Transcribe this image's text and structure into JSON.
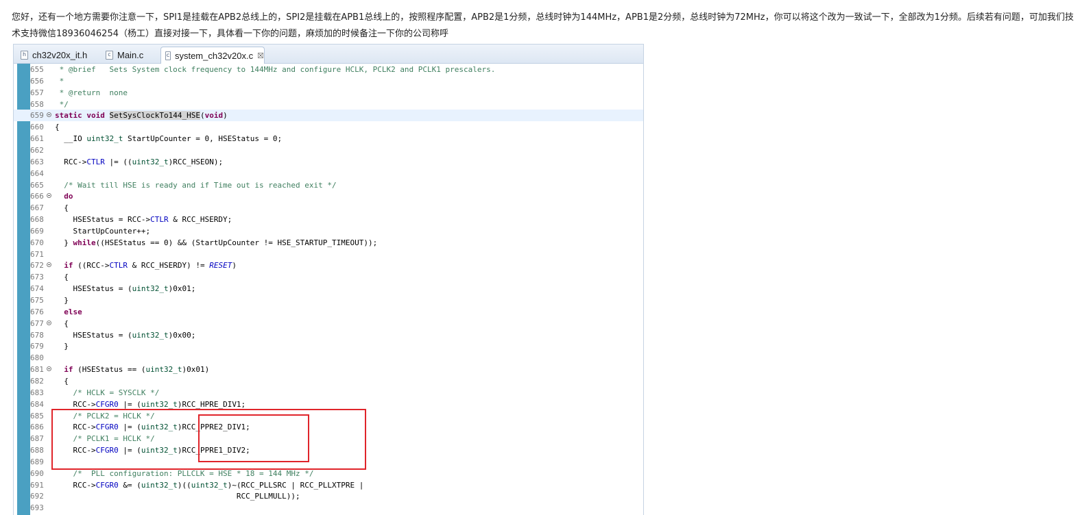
{
  "message": "您好，还有一个地方需要你注意一下，SPI1是挂载在APB2总线上的，SPI2是挂载在APB1总线上的，按照程序配置，APB2是1分频，总线时钟为144MHz，APB1是2分频，总线时钟为72MHz，你可以将这个改为一致试一下，全部改为1分频。后续若有问题，可加我们技术支持微信18936046254（杨工）直接对接一下，具体看一下你的问题，麻烦加的时候备注一下你的公司称呼",
  "tabs": [
    {
      "label": "ch32v20x_it.h",
      "icon": "h",
      "active": false
    },
    {
      "label": "Main.c",
      "icon": "c",
      "active": false
    },
    {
      "label": "system_ch32v20x.c",
      "icon": "c",
      "active": true,
      "close": "☒"
    }
  ],
  "colors": {
    "comment": "#3f7f5f",
    "keyword": "#7f0055",
    "field": "#0000c0",
    "type": "#005032",
    "highlight": "#e0242a",
    "marker": "#4aa0c2"
  },
  "lines": [
    {
      "n": "655",
      "t": [
        [
          "c",
          " * @brief   Sets System clock frequency to 144MHz and configure HCLK, PCLK2 and PCLK1 prescalers."
        ]
      ]
    },
    {
      "n": "656",
      "t": [
        [
          "c",
          " *"
        ]
      ]
    },
    {
      "n": "657",
      "t": [
        [
          "c",
          " * @return  none"
        ]
      ]
    },
    {
      "n": "658",
      "t": [
        [
          "c",
          " */"
        ]
      ]
    },
    {
      "n": "659",
      "fold": true,
      "cur": true,
      "t": [
        [
          "k",
          "static"
        ],
        [
          "",
          " "
        ],
        [
          "k",
          "void"
        ],
        [
          "",
          " "
        ],
        [
          "hl",
          "SetSysClockTo144_HSE"
        ],
        [
          "",
          "("
        ],
        [
          "k",
          "void"
        ],
        [
          "",
          ")"
        ]
      ]
    },
    {
      "n": "660",
      "t": [
        [
          "",
          "{"
        ]
      ]
    },
    {
      "n": "661",
      "t": [
        [
          "",
          "  __IO "
        ],
        [
          "t",
          "uint32_t"
        ],
        [
          "",
          " StartUpCounter = 0, HSEStatus = 0;"
        ]
      ]
    },
    {
      "n": "662",
      "t": []
    },
    {
      "n": "663",
      "t": [
        [
          "",
          "  RCC->"
        ],
        [
          "f",
          "CTLR"
        ],
        [
          "",
          " |= (("
        ],
        [
          "t",
          "uint32_t"
        ],
        [
          "",
          ")RCC_HSEON);"
        ]
      ]
    },
    {
      "n": "664",
      "t": []
    },
    {
      "n": "665",
      "t": [
        [
          "c",
          "  /* Wait till HSE is ready and if Time out is reached exit */"
        ]
      ]
    },
    {
      "n": "666",
      "fold": true,
      "t": [
        [
          "",
          "  "
        ],
        [
          "k",
          "do"
        ]
      ]
    },
    {
      "n": "667",
      "t": [
        [
          "",
          "  {"
        ]
      ]
    },
    {
      "n": "668",
      "t": [
        [
          "",
          "    HSEStatus = RCC->"
        ],
        [
          "f",
          "CTLR"
        ],
        [
          "",
          " & RCC_HSERDY;"
        ]
      ]
    },
    {
      "n": "669",
      "t": [
        [
          "",
          "    StartUpCounter++;"
        ]
      ]
    },
    {
      "n": "670",
      "t": [
        [
          "",
          "  } "
        ],
        [
          "k",
          "while"
        ],
        [
          "",
          "((HSEStatus == 0) && (StartUpCounter != HSE_STARTUP_TIMEOUT));"
        ]
      ]
    },
    {
      "n": "671",
      "t": []
    },
    {
      "n": "672",
      "fold": true,
      "t": [
        [
          "",
          "  "
        ],
        [
          "k",
          "if"
        ],
        [
          "",
          " ((RCC->"
        ],
        [
          "f",
          "CTLR"
        ],
        [
          "",
          " & RCC_HSERDY) != "
        ],
        [
          "i",
          "RESET"
        ],
        [
          "",
          ")"
        ]
      ]
    },
    {
      "n": "673",
      "t": [
        [
          "",
          "  {"
        ]
      ]
    },
    {
      "n": "674",
      "t": [
        [
          "",
          "    HSEStatus = ("
        ],
        [
          "t",
          "uint32_t"
        ],
        [
          "",
          ")0x01;"
        ]
      ]
    },
    {
      "n": "675",
      "t": [
        [
          "",
          "  }"
        ]
      ]
    },
    {
      "n": "676",
      "t": [
        [
          "",
          "  "
        ],
        [
          "k",
          "else"
        ]
      ]
    },
    {
      "n": "677",
      "fold": true,
      "t": [
        [
          "",
          "  {"
        ]
      ]
    },
    {
      "n": "678",
      "t": [
        [
          "",
          "    HSEStatus = ("
        ],
        [
          "t",
          "uint32_t"
        ],
        [
          "",
          ")0x00;"
        ]
      ]
    },
    {
      "n": "679",
      "t": [
        [
          "",
          "  }"
        ]
      ]
    },
    {
      "n": "680",
      "t": []
    },
    {
      "n": "681",
      "fold": true,
      "t": [
        [
          "",
          "  "
        ],
        [
          "k",
          "if"
        ],
        [
          "",
          " (HSEStatus == ("
        ],
        [
          "t",
          "uint32_t"
        ],
        [
          "",
          ")0x01)"
        ]
      ]
    },
    {
      "n": "682",
      "t": [
        [
          "",
          "  {"
        ]
      ]
    },
    {
      "n": "683",
      "t": [
        [
          "c",
          "    /* HCLK = SYSCLK */"
        ]
      ]
    },
    {
      "n": "684",
      "t": [
        [
          "",
          "    RCC->"
        ],
        [
          "f",
          "CFGR0"
        ],
        [
          "",
          " |= ("
        ],
        [
          "t",
          "uint32_t"
        ],
        [
          "",
          ")RCC_HPRE_DIV1;"
        ]
      ]
    },
    {
      "n": "685",
      "t": [
        [
          "c",
          "    /* PCLK2 = HCLK */"
        ]
      ]
    },
    {
      "n": "686",
      "t": [
        [
          "",
          "    RCC->"
        ],
        [
          "f",
          "CFGR0"
        ],
        [
          "",
          " |= ("
        ],
        [
          "t",
          "uint32_t"
        ],
        [
          "",
          ")RCC_PPRE2_DIV1;"
        ]
      ]
    },
    {
      "n": "687",
      "t": [
        [
          "c",
          "    /* PCLK1 = HCLK */"
        ]
      ]
    },
    {
      "n": "688",
      "t": [
        [
          "",
          "    RCC->"
        ],
        [
          "f",
          "CFGR0"
        ],
        [
          "",
          " |= ("
        ],
        [
          "t",
          "uint32_t"
        ],
        [
          "",
          ")RCC_PPRE1_DIV2;"
        ]
      ]
    },
    {
      "n": "689",
      "t": []
    },
    {
      "n": "690",
      "t": [
        [
          "c",
          "    /*  PLL configuration: PLLCLK = HSE * 18 = 144 MHz */"
        ]
      ]
    },
    {
      "n": "691",
      "t": [
        [
          "",
          "    RCC->"
        ],
        [
          "f",
          "CFGR0"
        ],
        [
          "",
          " &= ("
        ],
        [
          "t",
          "uint32_t"
        ],
        [
          "",
          ")(("
        ],
        [
          "t",
          "uint32_t"
        ],
        [
          "",
          ")~(RCC_PLLSRC | RCC_PLLXTPRE |"
        ]
      ]
    },
    {
      "n": "692",
      "t": [
        [
          "",
          "                                        RCC_PLLMULL));"
        ]
      ]
    },
    {
      "n": "693",
      "t": []
    }
  ]
}
